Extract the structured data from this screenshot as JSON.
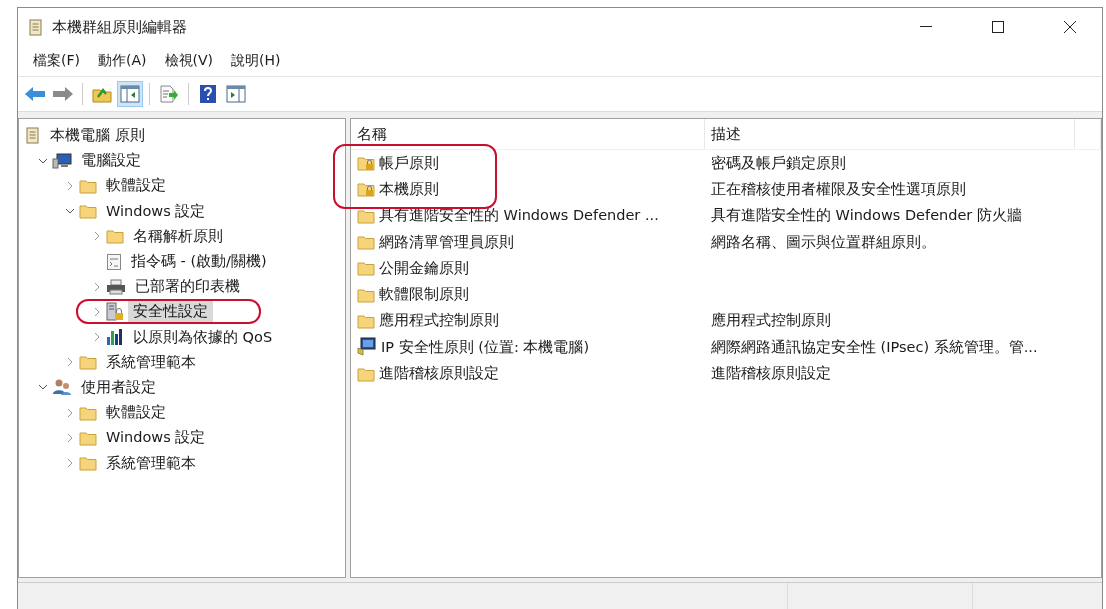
{
  "window": {
    "title": "本機群組原則編輯器"
  },
  "menu": [
    {
      "label": "檔案(F)"
    },
    {
      "label": "動作(A)"
    },
    {
      "label": "檢視(V)"
    },
    {
      "label": "說明(H)"
    }
  ],
  "toolbar": [
    {
      "kind": "back",
      "pressed": false
    },
    {
      "kind": "forward",
      "pressed": false
    },
    {
      "kind": "separator"
    },
    {
      "kind": "up",
      "pressed": false
    },
    {
      "kind": "tree",
      "pressed": true
    },
    {
      "kind": "separator"
    },
    {
      "kind": "export",
      "pressed": false
    },
    {
      "kind": "separator"
    },
    {
      "kind": "help",
      "pressed": false
    },
    {
      "kind": "actionpane",
      "pressed": false
    }
  ],
  "tree": [
    {
      "label": "本機電腦 原則",
      "kind": "policy",
      "expandable": false,
      "selected": false,
      "annotated": false,
      "children": [
        {
          "label": "電腦設定",
          "kind": "computer",
          "expandable": true,
          "expanded": true,
          "selected": false,
          "annotated": false,
          "children": [
            {
              "label": "軟體設定",
              "kind": "folder",
              "expandable": true,
              "expanded": false,
              "selected": false,
              "annotated": false
            },
            {
              "label": "Windows 設定",
              "kind": "folder",
              "expandable": true,
              "expanded": true,
              "selected": false,
              "annotated": false,
              "children": [
                {
                  "label": "名稱解析原則",
                  "kind": "folder",
                  "expandable": true,
                  "expanded": false,
                  "selected": false,
                  "annotated": false
                },
                {
                  "label": "指令碼 - (啟動/關機)",
                  "kind": "script",
                  "expandable": false,
                  "selected": false,
                  "annotated": false
                },
                {
                  "label": "已部署的印表機",
                  "kind": "printer",
                  "expandable": true,
                  "expanded": false,
                  "selected": false,
                  "annotated": false
                },
                {
                  "label": "安全性設定",
                  "kind": "security",
                  "expandable": true,
                  "expanded": false,
                  "selected": true,
                  "annotated": true
                },
                {
                  "label": "以原則為依據的 QoS",
                  "kind": "chart",
                  "expandable": true,
                  "expanded": false,
                  "selected": false,
                  "annotated": false
                }
              ]
            },
            {
              "label": "系統管理範本",
              "kind": "folder",
              "expandable": true,
              "expanded": false,
              "selected": false,
              "annotated": false
            }
          ]
        },
        {
          "label": "使用者設定",
          "kind": "users",
          "expandable": true,
          "expanded": true,
          "selected": false,
          "annotated": false,
          "children": [
            {
              "label": "軟體設定",
              "kind": "folder",
              "expandable": true,
              "expanded": false,
              "selected": false,
              "annotated": false
            },
            {
              "label": "Windows 設定",
              "kind": "folder",
              "expandable": true,
              "expanded": false,
              "selected": false,
              "annotated": false
            },
            {
              "label": "系統管理範本",
              "kind": "folder",
              "expandable": true,
              "expanded": false,
              "selected": false,
              "annotated": false
            }
          ]
        }
      ]
    }
  ],
  "list": {
    "columns": [
      "名稱",
      "描述"
    ],
    "rows": [
      {
        "name": "帳戶原則",
        "description": "密碼及帳戶鎖定原則",
        "kind": "locked",
        "annotated": true
      },
      {
        "name": "本機原則",
        "description": "正在稽核使用者權限及安全性選項原則",
        "kind": "locked",
        "annotated": true
      },
      {
        "name": "具有進階安全性的 Windows Defender ...",
        "description": "具有進階安全性的 Windows Defender 防火牆",
        "kind": "folder",
        "annotated": false
      },
      {
        "name": "網路清單管理員原則",
        "description": "網路名稱、圖示與位置群組原則。",
        "kind": "folder",
        "annotated": false
      },
      {
        "name": "公開金鑰原則",
        "kind": "folder",
        "annotated": false
      },
      {
        "name": "軟體限制原則",
        "kind": "folder",
        "annotated": false
      },
      {
        "name": "應用程式控制原則",
        "description": "應用程式控制原則",
        "kind": "folder",
        "annotated": false
      },
      {
        "name": "IP 安全性原則 (位置: 本機電腦)",
        "description": "網際網路通訊協定安全性 (IPsec) 系統管理。管...",
        "kind": "ipsec",
        "annotated": false
      },
      {
        "name": "進階稽核原則設定",
        "description": "進階稽核原則設定",
        "kind": "folder",
        "annotated": false
      }
    ]
  }
}
